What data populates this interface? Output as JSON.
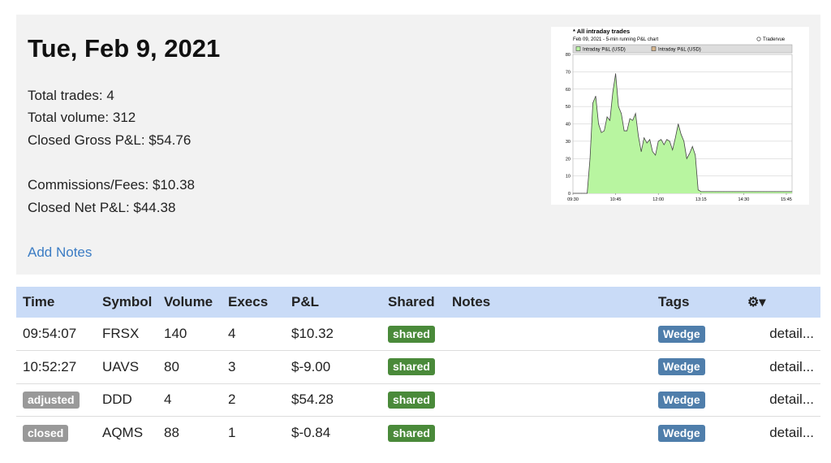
{
  "summary": {
    "date": "Tue, Feb 9, 2021",
    "total_trades": "Total trades: 4",
    "total_volume": "Total volume: 312",
    "closed_gross": "Closed Gross P&L: $54.76",
    "commissions": "Commissions/Fees: $10.38",
    "closed_net": "Closed Net P&L: $44.38",
    "add_notes": "Add Notes"
  },
  "chart_data": {
    "type": "area",
    "title": "* All intraday trades",
    "subtitle": "Feb 09, 2021 - 5-min running P&L chart",
    "brand": "Tradervue",
    "legend": [
      "Intraday P&L (USD)",
      "Intraday P&L (USD)"
    ],
    "legend_placement": "top-left",
    "grid": true,
    "fill_color": "#b8f5a0",
    "line_color": "#444444",
    "ylim": [
      0,
      80
    ],
    "yticks": [
      "0",
      "10",
      "20",
      "30",
      "40",
      "50",
      "60",
      "70",
      "80"
    ],
    "xticks": [
      "09:30",
      "10:45",
      "12:00",
      "13:15",
      "14:30",
      "15:45"
    ],
    "x": [
      "09:30",
      "09:35",
      "09:40",
      "09:45",
      "09:50",
      "09:55",
      "10:00",
      "10:05",
      "10:10",
      "10:15",
      "10:20",
      "10:25",
      "10:30",
      "10:35",
      "10:40",
      "10:45",
      "10:50",
      "10:55",
      "11:00",
      "11:05",
      "11:10",
      "11:15",
      "11:20",
      "11:25",
      "11:30",
      "11:35",
      "11:40",
      "11:45",
      "11:50",
      "11:55",
      "12:00",
      "12:05",
      "12:10",
      "12:15",
      "12:20",
      "12:25",
      "12:30",
      "12:35",
      "12:40",
      "12:45",
      "12:50",
      "12:55",
      "13:00",
      "13:05",
      "13:10",
      "13:15",
      "13:20",
      "13:25",
      "13:30",
      "13:35",
      "13:40",
      "13:45",
      "13:50",
      "13:55",
      "14:00",
      "14:05",
      "14:10",
      "14:15",
      "14:20",
      "14:25",
      "14:30",
      "14:35",
      "14:40",
      "14:45",
      "14:50",
      "14:55",
      "15:00",
      "15:05",
      "15:10",
      "15:15",
      "15:20",
      "15:25",
      "15:30",
      "15:35",
      "15:40",
      "15:45",
      "15:50",
      "15:55"
    ],
    "values": [
      0,
      0,
      0,
      0,
      0,
      0,
      20,
      52,
      56,
      40,
      35,
      36,
      44,
      42,
      58,
      69,
      50,
      46,
      36,
      36,
      43,
      42,
      46,
      33,
      24,
      32,
      29,
      31,
      24,
      22,
      30,
      31,
      28,
      31,
      30,
      25,
      32,
      40,
      34,
      30,
      20,
      23,
      27,
      22,
      2,
      1,
      1,
      1,
      1,
      1,
      1,
      1,
      1,
      1,
      1,
      1,
      1,
      1,
      1,
      1,
      1,
      1,
      1,
      1,
      1,
      1,
      1,
      1,
      1,
      1,
      1,
      1,
      1,
      1,
      1,
      1,
      1,
      1
    ]
  },
  "table": {
    "columns": [
      "Time",
      "Symbol",
      "Volume",
      "Execs",
      "P&L",
      "Shared",
      "Notes",
      "Tags"
    ],
    "gear": "⚙▾",
    "rows": [
      {
        "time": "09:54:07",
        "time_badge": false,
        "symbol": "FRSX",
        "volume": "140",
        "execs": "4",
        "pnl": "$10.32",
        "shared": "shared",
        "notes": "",
        "tag": "Wedge",
        "detail": "detail..."
      },
      {
        "time": "10:52:27",
        "time_badge": false,
        "symbol": "UAVS",
        "volume": "80",
        "execs": "3",
        "pnl": "$-9.00",
        "shared": "shared",
        "notes": "",
        "tag": "Wedge",
        "detail": "detail..."
      },
      {
        "time": "adjusted",
        "time_badge": true,
        "symbol": "DDD",
        "volume": "4",
        "execs": "2",
        "pnl": "$54.28",
        "shared": "shared",
        "notes": "",
        "tag": "Wedge",
        "detail": "detail..."
      },
      {
        "time": "closed",
        "time_badge": true,
        "symbol": "AQMS",
        "volume": "88",
        "execs": "1",
        "pnl": "$-0.84",
        "shared": "shared",
        "notes": "",
        "tag": "Wedge",
        "detail": "detail..."
      }
    ]
  }
}
